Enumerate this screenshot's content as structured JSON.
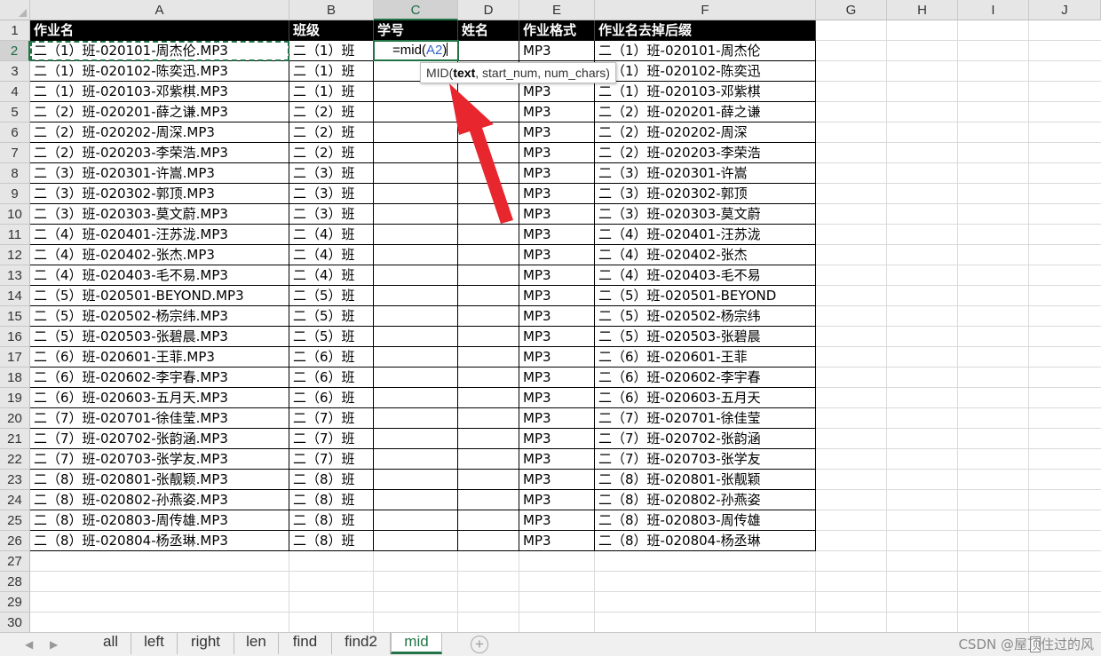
{
  "columns": [
    "A",
    "B",
    "C",
    "D",
    "E",
    "F",
    "G",
    "H",
    "I",
    "J"
  ],
  "selected_column": "C",
  "row_numbers": [
    1,
    2,
    3,
    4,
    5,
    6,
    7,
    8,
    9,
    10,
    11,
    12,
    13,
    14,
    15,
    16,
    17,
    18,
    19,
    20,
    21,
    22,
    23,
    24,
    25,
    26,
    27,
    28,
    29,
    30
  ],
  "selected_row": 2,
  "headers": {
    "a": "作业名",
    "b": "班级",
    "c": "学号",
    "d": "姓名",
    "e": "作业格式",
    "f": "作业名去掉后缀"
  },
  "active_cell": {
    "address": "C2",
    "formula_prefix": "=mid(",
    "formula_ref": "A2",
    "formula_suffix": ")"
  },
  "tooltip": {
    "fn": "MID(",
    "arg_bold": "text",
    "rest": ", start_num, num_chars)"
  },
  "rows": [
    {
      "a": "二（1）班-020101-周杰伦.MP3",
      "b": "二（1）班",
      "e": "",
      "f": "二（1）班-020101-周杰伦"
    },
    {
      "a": "二（1）班-020102-陈奕迅.MP3",
      "b": "二（1）班",
      "e": "",
      "f": "二（1）班-020102-陈奕迅"
    },
    {
      "a": "二（1）班-020103-邓紫棋.MP3",
      "b": "二（1）班",
      "e": "MP3",
      "f": "二（1）班-020103-邓紫棋"
    },
    {
      "a": "二（2）班-020201-薛之谦.MP3",
      "b": "二（2）班",
      "e": "MP3",
      "f": "二（2）班-020201-薛之谦"
    },
    {
      "a": "二（2）班-020202-周深.MP3",
      "b": "二（2）班",
      "e": "MP3",
      "f": "二（2）班-020202-周深"
    },
    {
      "a": "二（2）班-020203-李荣浩.MP3",
      "b": "二（2）班",
      "e": "MP3",
      "f": "二（2）班-020203-李荣浩"
    },
    {
      "a": "二（3）班-020301-许嵩.MP3",
      "b": "二（3）班",
      "e": "MP3",
      "f": "二（3）班-020301-许嵩"
    },
    {
      "a": "二（3）班-020302-郭顶.MP3",
      "b": "二（3）班",
      "e": "MP3",
      "f": "二（3）班-020302-郭顶"
    },
    {
      "a": "二（3）班-020303-莫文蔚.MP3",
      "b": "二（3）班",
      "e": "MP3",
      "f": "二（3）班-020303-莫文蔚"
    },
    {
      "a": "二（4）班-020401-汪苏泷.MP3",
      "b": "二（4）班",
      "e": "MP3",
      "f": "二（4）班-020401-汪苏泷"
    },
    {
      "a": "二（4）班-020402-张杰.MP3",
      "b": "二（4）班",
      "e": "MP3",
      "f": "二（4）班-020402-张杰"
    },
    {
      "a": "二（4）班-020403-毛不易.MP3",
      "b": "二（4）班",
      "e": "MP3",
      "f": "二（4）班-020403-毛不易"
    },
    {
      "a": "二（5）班-020501-BEYOND.MP3",
      "b": "二（5）班",
      "e": "MP3",
      "f": "二（5）班-020501-BEYOND"
    },
    {
      "a": "二（5）班-020502-杨宗纬.MP3",
      "b": "二（5）班",
      "e": "MP3",
      "f": "二（5）班-020502-杨宗纬"
    },
    {
      "a": "二（5）班-020503-张碧晨.MP3",
      "b": "二（5）班",
      "e": "MP3",
      "f": "二（5）班-020503-张碧晨"
    },
    {
      "a": "二（6）班-020601-王菲.MP3",
      "b": "二（6）班",
      "e": "MP3",
      "f": "二（6）班-020601-王菲"
    },
    {
      "a": "二（6）班-020602-李宇春.MP3",
      "b": "二（6）班",
      "e": "MP3",
      "f": "二（6）班-020602-李宇春"
    },
    {
      "a": "二（6）班-020603-五月天.MP3",
      "b": "二（6）班",
      "e": "MP3",
      "f": "二（6）班-020603-五月天"
    },
    {
      "a": "二（7）班-020701-徐佳莹.MP3",
      "b": "二（7）班",
      "e": "MP3",
      "f": "二（7）班-020701-徐佳莹"
    },
    {
      "a": "二（7）班-020702-张韵涵.MP3",
      "b": "二（7）班",
      "e": "MP3",
      "f": "二（7）班-020702-张韵涵"
    },
    {
      "a": "二（7）班-020703-张学友.MP3",
      "b": "二（7）班",
      "e": "MP3",
      "f": "二（7）班-020703-张学友"
    },
    {
      "a": "二（8）班-020801-张靓颖.MP3",
      "b": "二（8）班",
      "e": "MP3",
      "f": "二（8）班-020801-张靓颖"
    },
    {
      "a": "二（8）班-020802-孙燕姿.MP3",
      "b": "二（8）班",
      "e": "MP3",
      "f": "二（8）班-020802-孙燕姿"
    },
    {
      "a": "二（8）班-020803-周传雄.MP3",
      "b": "二（8）班",
      "e": "MP3",
      "f": "二（8）班-020803-周传雄"
    },
    {
      "a": "二（8）班-020804-杨丞琳.MP3",
      "b": "二（8）班",
      "e": "MP3",
      "f": "二（8）班-020804-杨丞琳"
    }
  ],
  "first_row_e": "MP3",
  "sheet_tabs": [
    "all",
    "left",
    "right",
    "len",
    "find",
    "find2",
    "mid"
  ],
  "active_tab": "mid",
  "nav_prev": "◀",
  "nav_next": "▶",
  "add_sheet": "+",
  "watermark": "CSDN @屋顶住过的风",
  "colors": {
    "accent": "#217346",
    "header_bg": "#000000",
    "header_fg": "#ffffff",
    "arrow": "#e8262d",
    "ref": "#3366cc"
  }
}
